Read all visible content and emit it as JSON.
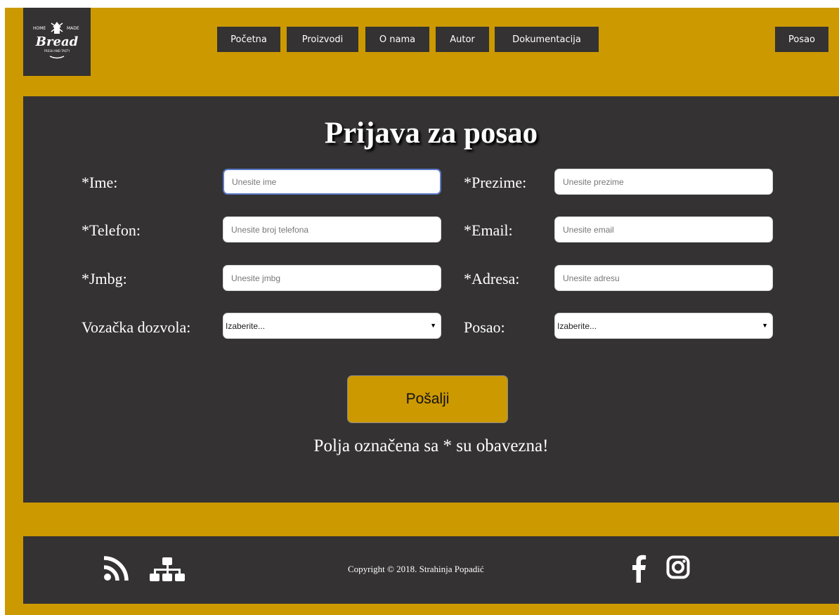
{
  "logo": {
    "alt_text": "HOME MADE Bread FRESH AND TASTY"
  },
  "nav": {
    "items": [
      "Početna",
      "Proizvodi",
      "O nama",
      "Autor",
      "Dokumentacija"
    ],
    "right_item": "Posao"
  },
  "form": {
    "title": "Prijava za posao",
    "fields": {
      "ime": {
        "label": "*Ime:",
        "placeholder": "Unesite ime"
      },
      "prezime": {
        "label": "*Prezime:",
        "placeholder": "Unesite prezime"
      },
      "telefon": {
        "label": "*Telefon:",
        "placeholder": "Unesite broj telefona"
      },
      "email": {
        "label": "*Email:",
        "placeholder": "Unesite email"
      },
      "jmbg": {
        "label": "*Jmbg:",
        "placeholder": "Unesite jmbg"
      },
      "adresa": {
        "label": "*Adresa:",
        "placeholder": "Unesite adresu"
      },
      "vozacka": {
        "label": "Vozačka dozvola:",
        "selected": "Izaberite..."
      },
      "posao": {
        "label": "Posao:",
        "selected": "Izaberite..."
      }
    },
    "submit_label": "Pošalji",
    "required_note": "Polja označena sa * su obavezna!"
  },
  "footer": {
    "copyright": "Copyright © 2018. Strahinja Popadić",
    "icons": [
      "rss-icon",
      "sitemap-icon",
      "facebook-icon",
      "instagram-icon"
    ]
  },
  "colors": {
    "brand_gold": "#cc9900",
    "panel_dark": "#343232",
    "focus_blue": "#5b78c7"
  }
}
